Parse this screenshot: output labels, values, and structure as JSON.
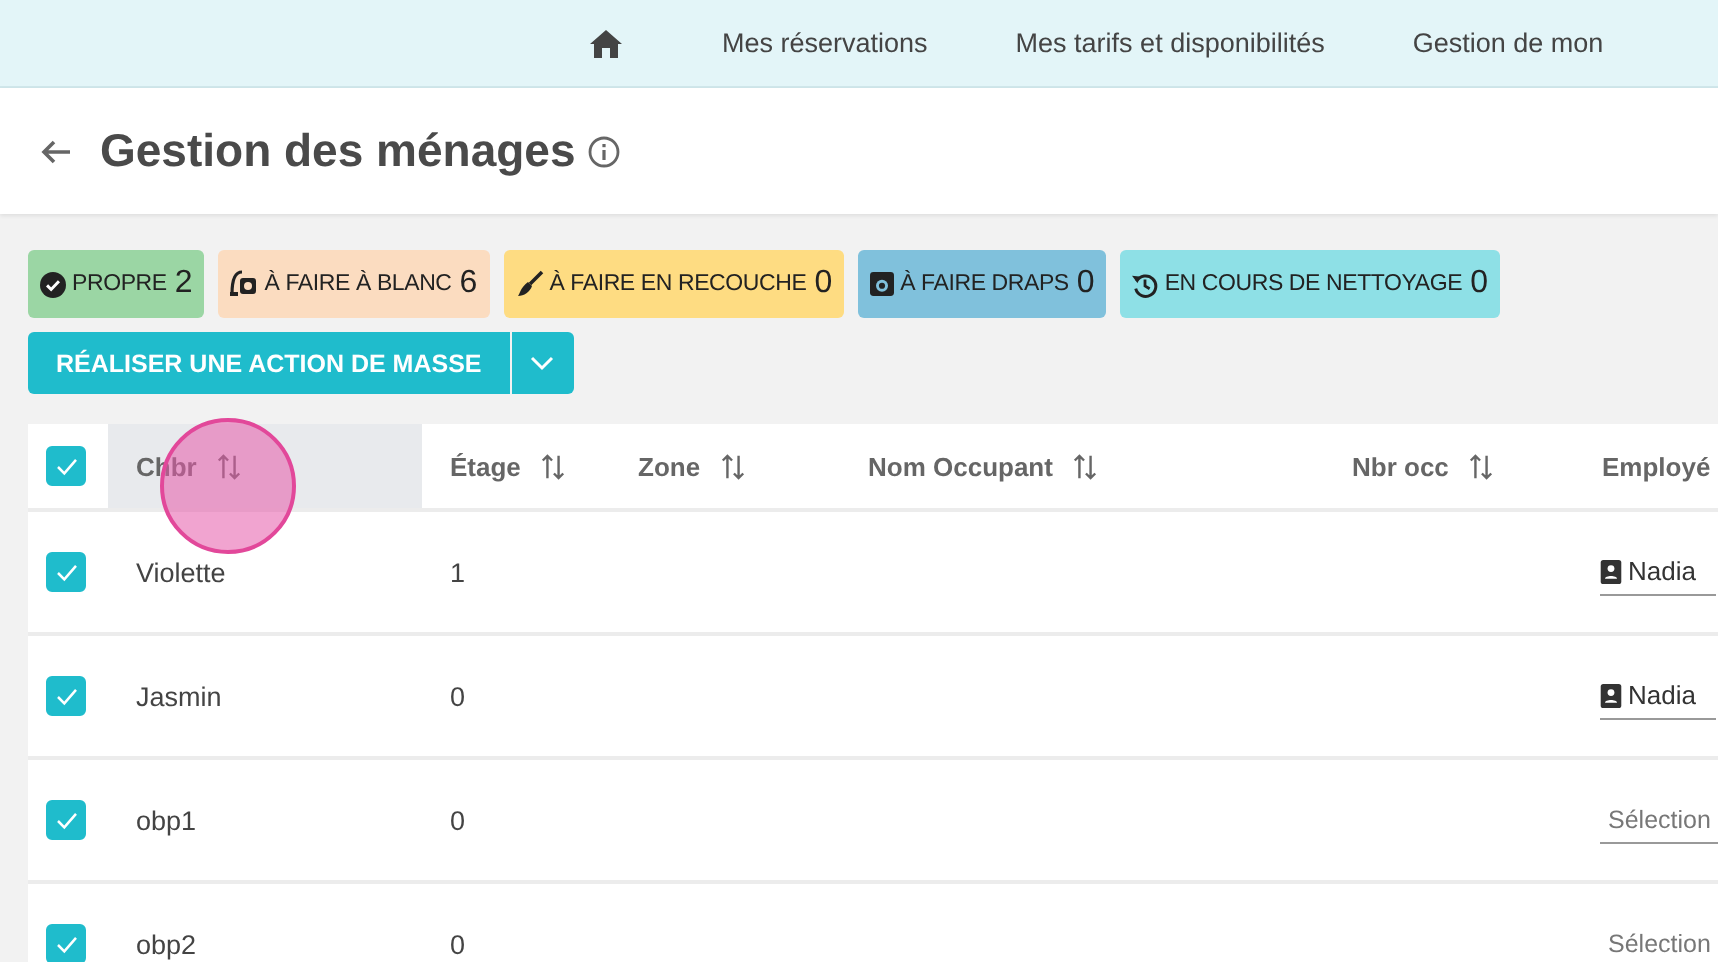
{
  "nav": {
    "items": [
      "Mes réservations",
      "Mes tarifs et disponibilités",
      "Gestion de mon"
    ]
  },
  "page": {
    "title": "Gestion des ménages"
  },
  "status_chips": [
    {
      "label": "PROPRE",
      "count": "2",
      "color": "#9bd6a4"
    },
    {
      "label": "À FAIRE À BLANC",
      "count": "6",
      "color": "#fbdcc0"
    },
    {
      "label": "À FAIRE EN RECOUCHE",
      "count": "0",
      "color": "#fedc82"
    },
    {
      "label": "À FAIRE DRAPS",
      "count": "0",
      "color": "#80c1dc"
    },
    {
      "label": "EN COURS DE NETTOYAGE",
      "count": "0",
      "color": "#8ee0e6"
    }
  ],
  "mass_action": {
    "label": "RÉALISER UNE ACTION DE MASSE"
  },
  "table": {
    "select_all": {
      "checked": true
    },
    "columns": [
      {
        "label": "Chbr",
        "sortable": true,
        "selected": true
      },
      {
        "label": "Étage",
        "sortable": true,
        "selected": false
      },
      {
        "label": "Zone",
        "sortable": true,
        "selected": false
      },
      {
        "label": "Nom Occupant",
        "sortable": true,
        "selected": false
      },
      {
        "label": "Nbr occ",
        "sortable": true,
        "selected": false
      },
      {
        "label": "Employé",
        "selected": false
      }
    ],
    "rows": [
      {
        "checked": true,
        "room": "Violette",
        "floor": "1",
        "employee": {
          "value": "Nadia"
        }
      },
      {
        "checked": true,
        "room": "Jasmin",
        "floor": "0",
        "employee": {
          "value": "Nadia"
        }
      },
      {
        "checked": true,
        "room": "obp1",
        "floor": "0",
        "employee": {
          "placeholder": "Sélection"
        }
      },
      {
        "checked": true,
        "room": "obp2",
        "floor": "0",
        "employee": {
          "placeholder": "Sélection"
        }
      }
    ]
  }
}
